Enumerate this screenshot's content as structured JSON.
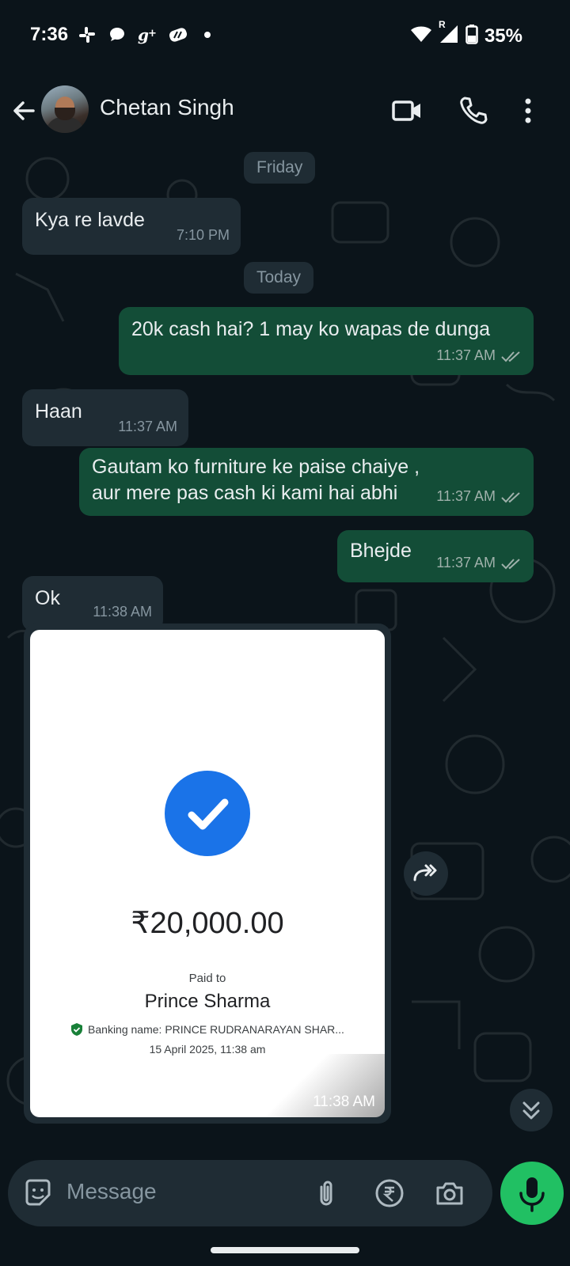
{
  "status_bar": {
    "time": "7:36",
    "battery": "35%",
    "notification_icons": [
      "slack-icon",
      "chat-icon",
      "google-plus-icon",
      "app-icon",
      "dot-icon"
    ],
    "roaming_label": "R"
  },
  "header": {
    "contact_name": "Chetan Singh",
    "icons": [
      "back-arrow-icon",
      "video-call-icon",
      "phone-icon",
      "more-vert-icon"
    ]
  },
  "chat": {
    "dates": {
      "friday": "Friday",
      "today": "Today"
    },
    "messages": [
      {
        "dir": "in",
        "text": "Kya re lavde",
        "time": "7:10 PM"
      },
      {
        "dir": "out",
        "text": "20k cash hai? 1 may ko wapas de dunga",
        "time": "11:37 AM",
        "status": "read"
      },
      {
        "dir": "in",
        "text": "Haan",
        "time": "11:37 AM"
      },
      {
        "dir": "out",
        "text": "Gautam ko furniture ke paise chaiye ,  aur mere pas cash ki kami hai abhi",
        "time": "11:37 AM",
        "status": "read"
      },
      {
        "dir": "out",
        "text": "Bhejde",
        "time": "11:37 AM",
        "status": "read"
      },
      {
        "dir": "in",
        "text": "Ok",
        "time": "11:38 AM"
      }
    ],
    "payment_image": {
      "amount": "₹20,000.00",
      "paid_to_label": "Paid to",
      "payee": "Prince Sharma",
      "banking_name": "Banking name: PRINCE RUDRANARAYAN SHAR...",
      "date": "15 April 2025, 11:38 am",
      "time": "11:38 AM"
    }
  },
  "input": {
    "placeholder": "Message"
  },
  "colors": {
    "background": "#0b141a",
    "incoming_bubble": "#1f2c34",
    "outgoing_bubble": "#134d37",
    "mic_button": "#21c063",
    "check_circle": "#1a73e8"
  }
}
